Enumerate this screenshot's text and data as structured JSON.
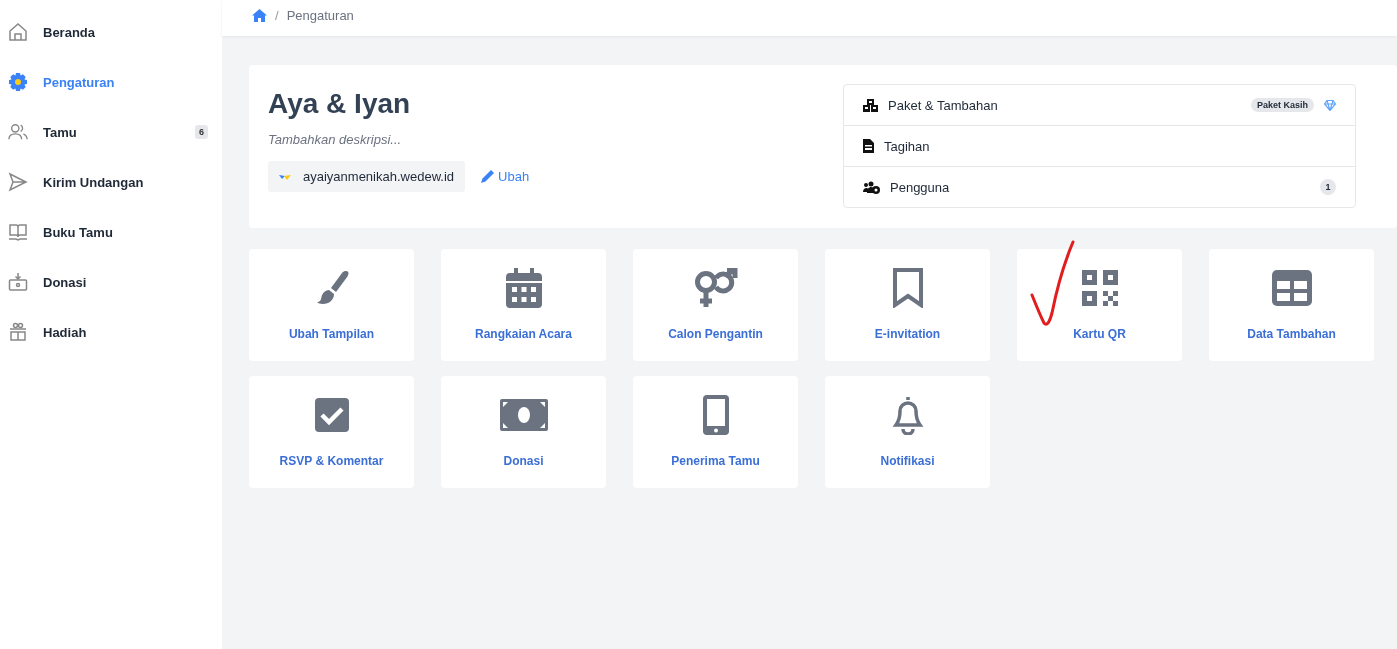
{
  "sidebar": {
    "items": [
      {
        "label": "Beranda",
        "selected": false
      },
      {
        "label": "Pengaturan",
        "selected": true
      },
      {
        "label": "Tamu",
        "selected": false,
        "badge": "6"
      },
      {
        "label": "Kirim Undangan",
        "selected": false
      },
      {
        "label": "Buku Tamu",
        "selected": false
      },
      {
        "label": "Donasi",
        "selected": false
      },
      {
        "label": "Hadiah",
        "selected": false
      }
    ]
  },
  "breadcrumb": {
    "separator": "/",
    "current": "Pengaturan"
  },
  "event": {
    "title": "Aya & Iyan",
    "description_placeholder": "Tambahkan deskripsi...",
    "domain": "ayaiyanmenikah.wedew.id",
    "edit_link": "Ubah"
  },
  "settings_menu": [
    {
      "label": "Paket & Tambahan",
      "tag": "Paket Kasih"
    },
    {
      "label": "Tagihan"
    },
    {
      "label": "Pengguna",
      "count": "1"
    }
  ],
  "tiles": [
    {
      "label": "Ubah Tampilan"
    },
    {
      "label": "Rangkaian Acara"
    },
    {
      "label": "Calon Pengantin"
    },
    {
      "label": "E-invitation"
    },
    {
      "label": "Kartu QR"
    },
    {
      "label": "Data Tambahan"
    },
    {
      "label": "RSVP & Komentar"
    },
    {
      "label": "Donasi"
    },
    {
      "label": "Penerima Tamu"
    },
    {
      "label": "Notifikasi"
    }
  ]
}
